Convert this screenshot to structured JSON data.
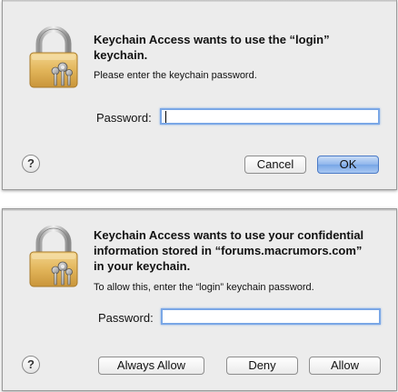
{
  "dialog1": {
    "title": "Keychain Access wants to use the “login” keychain.",
    "message": "Please enter the keychain password.",
    "password_label": "Password:",
    "password_value": "",
    "help_label": "?",
    "cancel_label": "Cancel",
    "ok_label": "OK"
  },
  "dialog2": {
    "title": "Keychain Access wants to use your confidential information stored in “forums.macrumors.com” in your keychain.",
    "message": "To allow this, enter the “login” keychain password.",
    "password_label": "Password:",
    "password_value": "",
    "help_label": "?",
    "always_allow_label": "Always Allow",
    "deny_label": "Deny",
    "allow_label": "Allow"
  },
  "colors": {
    "dialog_bg": "#ececec",
    "focus_ring": "#7aa7e6",
    "default_button": "#8fb6ec"
  },
  "icons": {
    "lock": "padlock-with-keys-icon",
    "help": "question-mark-icon"
  }
}
